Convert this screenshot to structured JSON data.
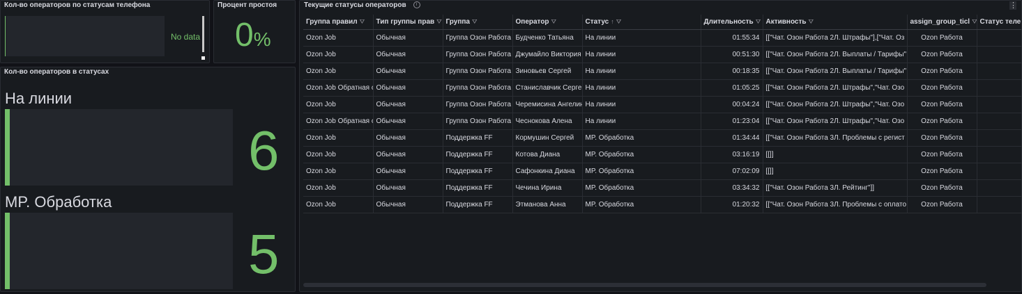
{
  "panels": {
    "phone_status": {
      "title": "Кол-во операторов по статусам телефона",
      "no_data": "No data"
    },
    "idle_percent": {
      "title": "Процент простоя",
      "value": "0",
      "unit": "%"
    },
    "operators_status": {
      "title": "Кол-во операторов в статусах",
      "stats": [
        {
          "label": "На линии",
          "value": "6"
        },
        {
          "label": "MP. Обработка",
          "value": "5"
        }
      ]
    },
    "current_status": {
      "title": "Текущие статусы операторов",
      "info_icon": "i",
      "menu_icon": "⋮",
      "columns": [
        "Группа правил",
        "Тип группы прав",
        "Группа",
        "Оператор",
        "Статус",
        "Длительность",
        "Активность",
        "assign_group_ticl",
        "Статус теле"
      ],
      "sort_indicator": "↑",
      "filter_icon": "⛛",
      "rows": [
        [
          "Ozon Job",
          "Обычная",
          "Группа Озон Работа",
          "Будченко Татьяна",
          "На линии",
          "01:55:34",
          "[[\"Чат. Озон Работа 2Л. Штрафы\"],[\"Чат. Оз",
          "Ozon Работа",
          ""
        ],
        [
          "Ozon Job",
          "Обычная",
          "Группа Озон Работа",
          "Джумайло Виктория",
          "На линии",
          "00:51:30",
          "[[\"Чат. Озон Работа 2Л. Выплаты / Тарифы\"",
          "Ozon Работа",
          ""
        ],
        [
          "Ozon Job",
          "Обычная",
          "Группа Озон Работа",
          "Зиновьев Сергей",
          "На линии",
          "00:18:35",
          "[[\"Чат. Озон Работа 2Л. Выплаты / Тарифы\"",
          "Ozon Работа",
          ""
        ],
        [
          "Ozon Job Обратная свя",
          "Обычная",
          "Группа Озон Работа",
          "Станиславчик Сергей",
          "На линии",
          "01:05:25",
          "[[\"Чат. Озон Работа 2Л. Штрафы\",\"Чат. Озо",
          "Ozon Работа",
          ""
        ],
        [
          "Ozon Job",
          "Обычная",
          "Группа Озон Работа",
          "Черемисина Ангелина",
          "На линии",
          "00:04:24",
          "[[\"Чат. Озон Работа 2Л. Штрафы\",\"Чат. Озо",
          "Ozon Работа",
          ""
        ],
        [
          "Ozon Job Обратная свя",
          "Обычная",
          "Группа Озон Работа",
          "Чеснокова Алена",
          "На линии",
          "01:23:04",
          "[[\"Чат. Озон Работа 2Л. Штрафы\",\"Чат. Озо",
          "Ozon Работа",
          ""
        ],
        [
          "Ozon Job",
          "Обычная",
          "Поддержка FF",
          "Кормушин Сергей",
          "MP. Обработка",
          "01:34:44",
          "[[\"Чат. Озон Работа 3Л. Проблемы с регист",
          "Ozon Работа",
          ""
        ],
        [
          "Ozon Job",
          "Обычная",
          "Поддержка FF",
          "Котова Диана",
          "MP. Обработка",
          "03:16:19",
          "[[]]",
          "Ozon Работа",
          ""
        ],
        [
          "Ozon Job",
          "Обычная",
          "Поддержка FF",
          "Сафонкина Диана",
          "MP. Обработка",
          "07:02:09",
          "[[]]",
          "Ozon Работа",
          ""
        ],
        [
          "Ozon Job",
          "Обычная",
          "Поддержка FF",
          "Чечина Ирина",
          "MP. Обработка",
          "03:34:32",
          "[[\"Чат. Озон Работа 3Л. Рейтинг\"]]",
          "Ozon Работа",
          ""
        ],
        [
          "Ozon Job",
          "Обычная",
          "Поддержка FF",
          "Этманова Анна",
          "MP. Обработка",
          "01:20:32",
          "[[\"Чат. Озон Работа 3Л. Проблемы с оплато",
          "Ozon Работа",
          ""
        ]
      ]
    }
  },
  "colors": {
    "accent": "#73bf69",
    "background": "#111217",
    "panel": "#181b1f"
  }
}
